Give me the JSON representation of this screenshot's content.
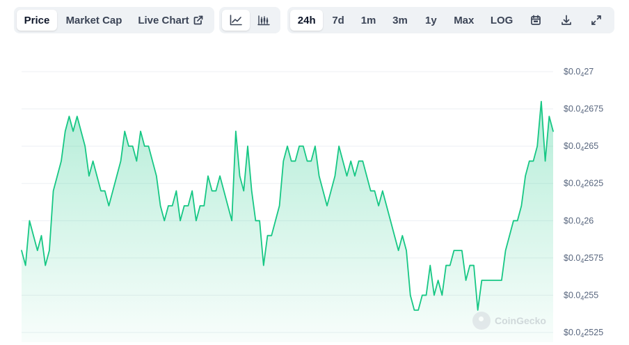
{
  "toolbar": {
    "data_type_tabs": [
      {
        "label": "Price",
        "active": true
      },
      {
        "label": "Market Cap",
        "active": false
      },
      {
        "label": "Live Chart",
        "active": false,
        "icon": "external-link-icon"
      }
    ],
    "chart_type_buttons": [
      {
        "icon": "line-chart-icon",
        "active": true
      },
      {
        "icon": "candlestick-chart-icon",
        "active": false
      }
    ],
    "range_tabs": [
      {
        "label": "24h",
        "active": true
      },
      {
        "label": "7d",
        "active": false
      },
      {
        "label": "1m",
        "active": false
      },
      {
        "label": "3m",
        "active": false
      },
      {
        "label": "1y",
        "active": false
      },
      {
        "label": "Max",
        "active": false
      },
      {
        "label": "LOG",
        "active": false
      }
    ],
    "tool_buttons": [
      {
        "icon": "calendar-icon"
      },
      {
        "icon": "download-icon"
      },
      {
        "icon": "expand-icon"
      }
    ]
  },
  "watermark": "CoinGecko",
  "colors": {
    "line": "#16c784",
    "fill_top": "#16c784",
    "grid": "#eceff3",
    "toolbar_bg": "#eff2f5"
  },
  "chart_data": {
    "type": "area",
    "title": "",
    "xlabel": "",
    "ylabel": "",
    "x_range": "24h",
    "ylim": [
      2.52e-05,
      2.71e-05
    ],
    "ytick_labels": [
      {
        "value": 2.7e-05,
        "prefix": "$0.0",
        "sub": "4",
        "digits": "27"
      },
      {
        "value": 2.675e-05,
        "prefix": "$0.0",
        "sub": "4",
        "digits": "2675"
      },
      {
        "value": 2.65e-05,
        "prefix": "$0.0",
        "sub": "4",
        "digits": "265"
      },
      {
        "value": 2.625e-05,
        "prefix": "$0.0",
        "sub": "4",
        "digits": "2625"
      },
      {
        "value": 2.6e-05,
        "prefix": "$0.0",
        "sub": "4",
        "digits": "26"
      },
      {
        "value": 2.575e-05,
        "prefix": "$0.0",
        "sub": "4",
        "digits": "2575"
      },
      {
        "value": 2.55e-05,
        "prefix": "$0.0",
        "sub": "4",
        "digits": "255"
      },
      {
        "value": 2.525e-05,
        "prefix": "$0.0",
        "sub": "4",
        "digits": "2525"
      }
    ],
    "grid": true,
    "series": [
      {
        "values": [
          2.58e-05,
          2.57e-05,
          2.6e-05,
          2.59e-05,
          2.58e-05,
          2.59e-05,
          2.57e-05,
          2.58e-05,
          2.62e-05,
          2.63e-05,
          2.64e-05,
          2.66e-05,
          2.67e-05,
          2.66e-05,
          2.67e-05,
          2.66e-05,
          2.65e-05,
          2.63e-05,
          2.64e-05,
          2.63e-05,
          2.62e-05,
          2.62e-05,
          2.61e-05,
          2.62e-05,
          2.63e-05,
          2.64e-05,
          2.66e-05,
          2.65e-05,
          2.65e-05,
          2.64e-05,
          2.66e-05,
          2.65e-05,
          2.65e-05,
          2.64e-05,
          2.63e-05,
          2.61e-05,
          2.6e-05,
          2.61e-05,
          2.61e-05,
          2.62e-05,
          2.6e-05,
          2.61e-05,
          2.61e-05,
          2.62e-05,
          2.6e-05,
          2.61e-05,
          2.61e-05,
          2.63e-05,
          2.62e-05,
          2.62e-05,
          2.63e-05,
          2.62e-05,
          2.61e-05,
          2.6e-05,
          2.66e-05,
          2.63e-05,
          2.62e-05,
          2.65e-05,
          2.62e-05,
          2.6e-05,
          2.6e-05,
          2.57e-05,
          2.59e-05,
          2.59e-05,
          2.6e-05,
          2.61e-05,
          2.64e-05,
          2.65e-05,
          2.64e-05,
          2.64e-05,
          2.65e-05,
          2.65e-05,
          2.64e-05,
          2.64e-05,
          2.65e-05,
          2.63e-05,
          2.62e-05,
          2.61e-05,
          2.62e-05,
          2.63e-05,
          2.65e-05,
          2.64e-05,
          2.63e-05,
          2.64e-05,
          2.63e-05,
          2.64e-05,
          2.64e-05,
          2.63e-05,
          2.62e-05,
          2.62e-05,
          2.61e-05,
          2.62e-05,
          2.61e-05,
          2.6e-05,
          2.59e-05,
          2.58e-05,
          2.59e-05,
          2.58e-05,
          2.55e-05,
          2.54e-05,
          2.54e-05,
          2.55e-05,
          2.55e-05,
          2.57e-05,
          2.55e-05,
          2.56e-05,
          2.55e-05,
          2.57e-05,
          2.57e-05,
          2.58e-05,
          2.58e-05,
          2.58e-05,
          2.56e-05,
          2.57e-05,
          2.57e-05,
          2.54e-05,
          2.56e-05,
          2.56e-05,
          2.56e-05,
          2.56e-05,
          2.56e-05,
          2.56e-05,
          2.58e-05,
          2.59e-05,
          2.6e-05,
          2.6e-05,
          2.61e-05,
          2.63e-05,
          2.64e-05,
          2.64e-05,
          2.65e-05,
          2.68e-05,
          2.64e-05,
          2.67e-05,
          2.66e-05
        ]
      }
    ]
  }
}
